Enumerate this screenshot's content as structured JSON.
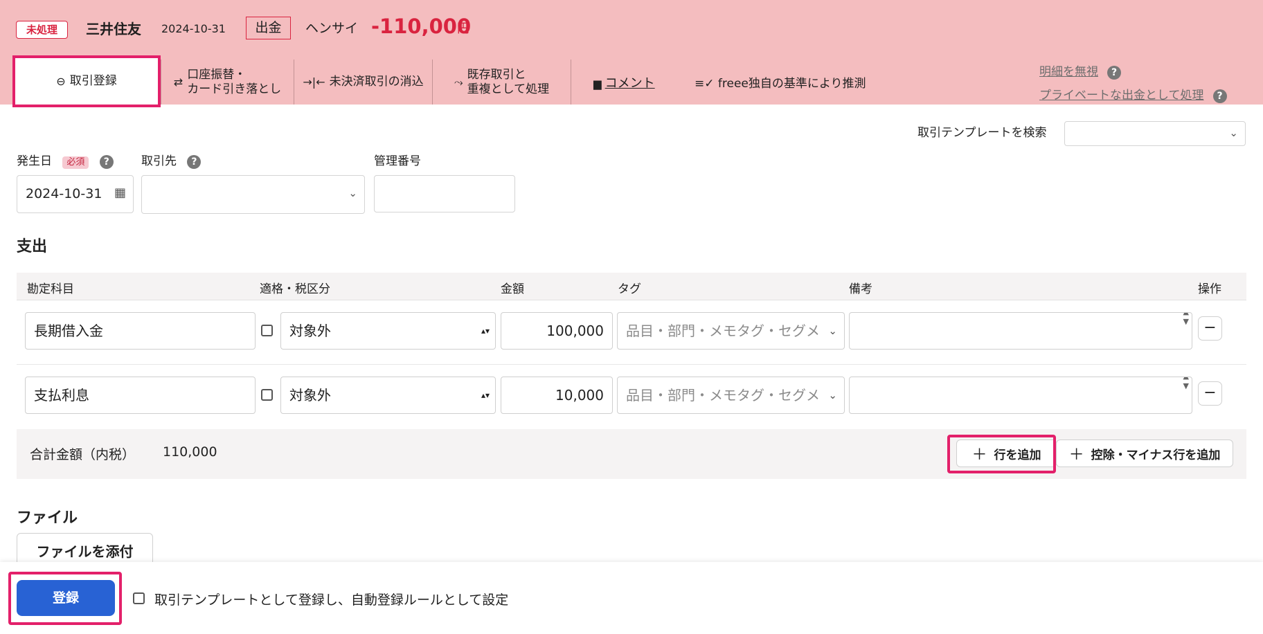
{
  "header": {
    "status": "未処理",
    "bank": "三井住友",
    "date": "2024-10-31",
    "direction": "出金",
    "partner": "ヘンサイ",
    "amount": "-110,000",
    "currency": "円",
    "tabs": [
      {
        "label": "取引登録",
        "icon": "minus-circle-icon"
      },
      {
        "label_line1": "口座振替・",
        "label_line2": "カード引き落とし",
        "icon": "swap-arrows-icon"
      },
      {
        "label": "未決済取引の消込",
        "icon": "reconcile-icon"
      },
      {
        "label_line1": "既存取引と",
        "label_line2": "重複として処理",
        "icon": "merge-icon"
      }
    ],
    "comment_link": "コメント",
    "freee_guess": "freee独自の基準により推測",
    "ignore_link": "明細を無視",
    "private_link": "プライベートな出金として処理"
  },
  "form": {
    "template_search_label": "取引テンプレートを検索",
    "date_label": "発生日",
    "required_badge": "必須",
    "date_value": "2024-10-31",
    "partner_label": "取引先",
    "mgmt_label": "管理番号"
  },
  "expense": {
    "section_title": "支出",
    "columns": [
      "勘定科目",
      "適格・税区分",
      "金額",
      "タグ",
      "備考",
      "操作"
    ],
    "rows": [
      {
        "account": "長期借入金",
        "tax": "対象外",
        "amount": "100,000",
        "tag_placeholder": "品目・部門・メモタグ・セグメ"
      },
      {
        "account": "支払利息",
        "tax": "対象外",
        "amount": "10,000",
        "tag_placeholder": "品目・部門・メモタグ・セグメ"
      }
    ],
    "total_label": "合計金額（内税）",
    "total_value": "110,000",
    "add_row": "行を追加",
    "add_deduct_row": "控除・マイナス行を追加"
  },
  "file": {
    "section_title": "ファイル",
    "attach_button": "ファイルを添付"
  },
  "footer": {
    "submit": "登録",
    "template_checkbox_label": "取引テンプレートとして登録し、自動登録ルールとして設定"
  },
  "colors": {
    "header_bg": "#f4bdbf",
    "accent_red": "#d9233f",
    "highlight": "#e3206a",
    "primary": "#2862d4"
  }
}
